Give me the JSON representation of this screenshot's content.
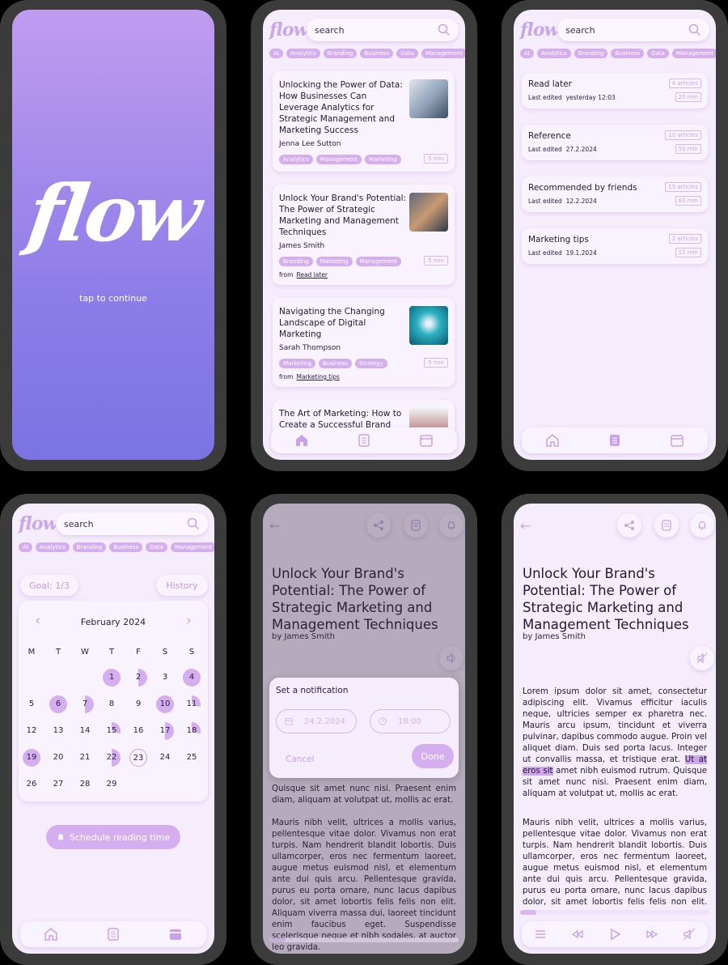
{
  "splash": {
    "logo": "flow",
    "tap": "tap to continue"
  },
  "brand": {
    "mini_logo": "flow",
    "accent": "#d5aeef",
    "gradient_top": "#c19cf0",
    "gradient_bottom": "#7b73e3"
  },
  "search": {
    "placeholder": "search"
  },
  "tags": [
    "AI",
    "Analytics",
    "Branding",
    "Business",
    "Data",
    "Management"
  ],
  "feed": [
    {
      "title": "Unlocking the Power of Data: How Businesses Can Leverage Analytics for Strategic Management and Marketing Success",
      "author": "Jenna Lee Sutton",
      "chips": [
        "Analytics",
        "Management",
        "Marketing"
      ],
      "mins": "5 min",
      "from": ""
    },
    {
      "title": "Unlock Your Brand's Potential: The Power of Strategic Marketing and Management Techniques",
      "author": "James Smith",
      "chips": [
        "Branding",
        "Marketing",
        "Management"
      ],
      "mins": "5 min",
      "from_label": "from",
      "from": "Read later"
    },
    {
      "title": "Navigating the Changing Landscape of Digital Marketing",
      "author": "Sarah Thompson",
      "chips": [
        "Marketing",
        "Business",
        "Strategy"
      ],
      "mins": "5 min",
      "from_label": "from",
      "from": "Marketing tips"
    },
    {
      "title": "The Art of Marketing: How to Create a Successful Brand"
    }
  ],
  "lists": [
    {
      "name": "Read later",
      "edited_label": "Last edited",
      "edited": "yesterday 12:03",
      "count": "4 articles",
      "mins": "20 min"
    },
    {
      "name": "Reference",
      "edited_label": "Last edited",
      "edited": "27.2.2024",
      "count": "10 articles",
      "mins": "50 min"
    },
    {
      "name": "Recommended by friends",
      "edited_label": "Last edited",
      "edited": "12.2.2024",
      "count": "15 articles",
      "mins": "60 min"
    },
    {
      "name": "Marketing tips",
      "edited_label": "Last edited",
      "edited": "19.1.2024",
      "count": "2 articles",
      "mins": "12 min"
    }
  ],
  "calendar": {
    "goal": "Goal: 1/3",
    "history": "History",
    "month": "February 2024",
    "dow": [
      "M",
      "T",
      "W",
      "T",
      "F",
      "S",
      "S"
    ],
    "days": [
      {
        "d": "1",
        "s": "full"
      },
      {
        "d": "2",
        "s": "half"
      },
      {
        "d": "3",
        "s": ""
      },
      {
        "d": "4",
        "s": "full"
      },
      {
        "d": "5",
        "s": ""
      },
      {
        "d": "6",
        "s": "full"
      },
      {
        "d": "7",
        "s": "half"
      },
      {
        "d": "8",
        "s": ""
      },
      {
        "d": "9",
        "s": ""
      },
      {
        "d": "10",
        "s": "full"
      },
      {
        "d": "11",
        "s": "q"
      },
      {
        "d": "12",
        "s": ""
      },
      {
        "d": "13",
        "s": ""
      },
      {
        "d": "14",
        "s": ""
      },
      {
        "d": "15",
        "s": "q"
      },
      {
        "d": "16",
        "s": ""
      },
      {
        "d": "17",
        "s": "half"
      },
      {
        "d": "18",
        "s": "q"
      },
      {
        "d": "19",
        "s": "full"
      },
      {
        "d": "20",
        "s": ""
      },
      {
        "d": "21",
        "s": ""
      },
      {
        "d": "22",
        "s": "half"
      },
      {
        "d": "23",
        "s": "ring"
      },
      {
        "d": "24",
        "s": ""
      },
      {
        "d": "25",
        "s": ""
      },
      {
        "d": "26",
        "s": ""
      },
      {
        "d": "27",
        "s": ""
      },
      {
        "d": "28",
        "s": ""
      },
      {
        "d": "29",
        "s": ""
      }
    ],
    "schedule": "Schedule reading time"
  },
  "article": {
    "title": "Unlock Your Brand's Potential: The Power of Strategic Marketing and Management Techniques",
    "by": "by James Smith",
    "p1a": "Lorem ipsum dolor sit amet, consectetur adipiscing elit. Vivamus efficitur iaculis neque, ultricies semper ex pharetra nec. Mauris arcu ipsum, tincidunt et viverra pulvinar, dapibus commodo augue. Proin vel aliquet diam. Duis sed porta lacus. Integer ut convallis massa, et tristique erat.",
    "highlight": "Ut at eros sit",
    "p1b": "amet nibh euismod rutrum. Quisque sit amet nunc nisi. Praesent enim diam, aliquam at volutpat ut, mollis ac erat.",
    "p1tail": "Quisque sit amet nunc nisi. Praesent enim diam, aliquam at volutpat ut, mollis ac erat.",
    "p2": "Mauris nibh velit, ultrices a mollis varius, pellentesque vitae dolor. Vivamus non erat turpis. Nam hendrerit blandit lobortis. Duis ullamcorper, eros nec fermentum laoreet, augue metus euismod nisl, et elementum ante dui quis arcu. Pellentesque gravida, purus eu porta ornare, nunc lacus dapibus dolor, sit amet lobortis felis felis non elit. Aliquam viverra massa dui, laoreet tincidunt enim faucibus eget. Suspendisse scelerisque neque et nibh sodales, at auctor leo gravida."
  },
  "notification": {
    "title": "Set a notification",
    "date": "24.2.2024",
    "time": "18:00",
    "cancel": "Cancel",
    "done": "Done"
  }
}
